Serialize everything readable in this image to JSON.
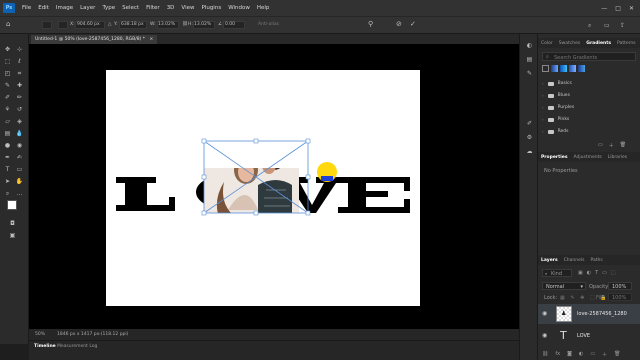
{
  "menubar": {
    "logo": "Ps",
    "items": [
      "File",
      "Edit",
      "Image",
      "Layer",
      "Type",
      "Select",
      "Filter",
      "3D",
      "View",
      "Plugins",
      "Window",
      "Help"
    ]
  },
  "options": {
    "x_value": "904.60 px",
    "y_value": "638.18 px",
    "w_value": "13.02%",
    "h_value": "13.02%",
    "angle_value": "0.00",
    "anti_alias": "Anti-alias"
  },
  "document_tab": {
    "title": "Untitled-1 @ 50% (love-2587456_1280, RGB/8) *",
    "close": "×"
  },
  "canvas": {
    "word": "LOVE"
  },
  "status": {
    "zoom": "50%",
    "doc_info": "1846 px x 1417 px (118.12 ppi)"
  },
  "timeline": {
    "tabs": [
      "Timeline",
      "Measurement Log"
    ]
  },
  "panels": {
    "gradients": {
      "tabs": [
        "Color",
        "Swatches",
        "Gradients",
        "Patterns"
      ],
      "active": "Gradients",
      "search_placeholder": "Search Gradients",
      "folders": [
        "Basics",
        "Blues",
        "Purples",
        "Pinks",
        "Reds"
      ]
    },
    "properties": {
      "tabs": [
        "Properties",
        "Adjustments",
        "Libraries"
      ],
      "active": "Properties",
      "empty_text": "No Properties"
    },
    "layers": {
      "tabs": [
        "Layers",
        "Channels",
        "Paths"
      ],
      "active": "Layers",
      "kind_label": "Kind",
      "blend_mode": "Normal",
      "opacity_label": "Opacity:",
      "opacity_value": "100%",
      "lock_label": "Lock:",
      "fill_label": "Fill:",
      "fill_value": "100%",
      "items": [
        {
          "name": "love-2587456_1280",
          "type": "image",
          "selected": true
        },
        {
          "name": "LOVE",
          "type": "text",
          "selected": false
        }
      ]
    }
  },
  "colors": {
    "accent": "#2c7fd6",
    "highlight": "#ffd600",
    "selection": "#3a3f46"
  }
}
